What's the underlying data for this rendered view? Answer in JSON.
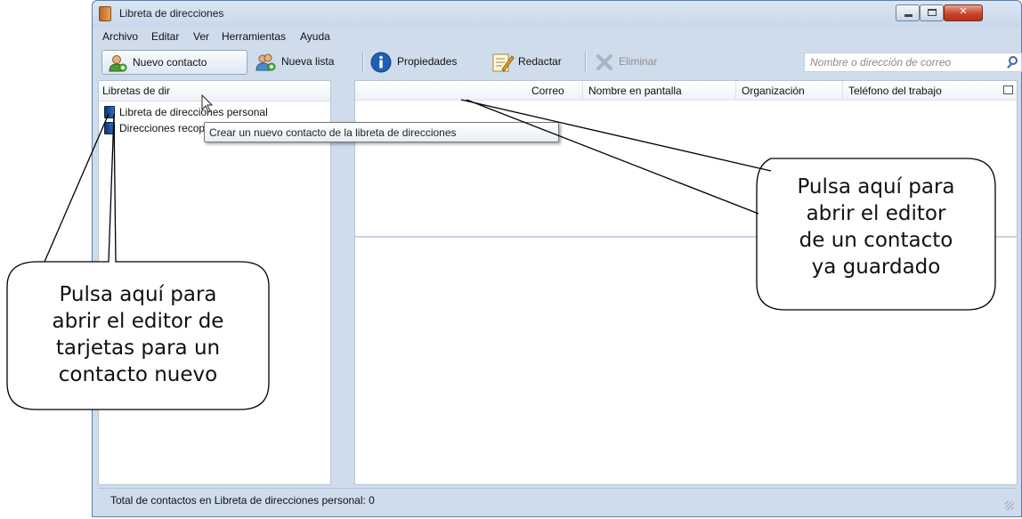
{
  "window": {
    "title": "Libreta de direcciones",
    "minimize_glyph": "",
    "close_glyph": "✕"
  },
  "menu": {
    "archivo": "Archivo",
    "editar": "Editar",
    "ver": "Ver",
    "herramientas": "Herramientas",
    "ayuda": "Ayuda"
  },
  "toolbar": {
    "new_contact": "Nuevo contacto",
    "new_list": "Nueva lista",
    "properties": "Propiedades",
    "compose": "Redactar",
    "delete": "Eliminar",
    "search_placeholder": "Nombre o dirección de correo"
  },
  "left_pane": {
    "header": "Libretas de dir",
    "items": [
      "Libreta de direcciones personal",
      "Direcciones recopiladas"
    ]
  },
  "columns": [
    "Correo",
    "Nombre en pantalla",
    "Organización",
    "Teléfono del trabajo"
  ],
  "tooltip": "Crear un nuevo contacto de la libreta de direcciones",
  "status": "Total de contactos en Libreta de direcciones personal: 0",
  "callouts": {
    "left": [
      "Pulsa aquí para",
      "abrir el editor de",
      "tarjetas para un",
      "contacto nuevo"
    ],
    "right": [
      "Pulsa aquí para",
      "abrir el editor",
      "de un contacto",
      "ya guardado"
    ]
  },
  "icons": {
    "app": "address-book-icon",
    "new_contact": "person-add-icon",
    "new_list": "people-add-icon",
    "properties": "info-icon",
    "compose": "compose-icon",
    "delete": "delete-x-icon",
    "search": "search-icon"
  },
  "colors": {
    "chrome": "#cfdcec",
    "info_blue": "#1d5fb8",
    "close_red": "#c8452d"
  }
}
